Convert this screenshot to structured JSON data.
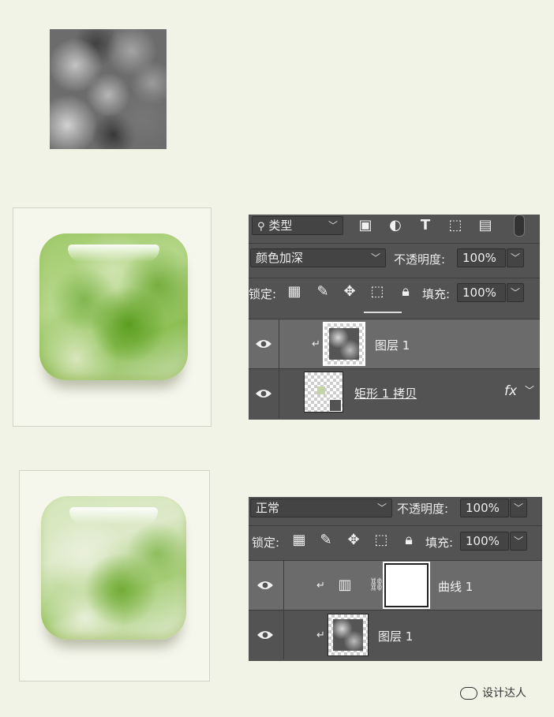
{
  "panel1": {
    "filter_kind_label": "类型",
    "blend_mode": "颜色加深",
    "opacity_label": "不透明度:",
    "opacity_value": "100%",
    "lock_label": "锁定:",
    "fill_label": "填充:",
    "fill_value": "100%",
    "layers": [
      {
        "name": "图层 1",
        "selected": true,
        "clipped": true
      },
      {
        "name": "矩形 1 拷贝",
        "selected": false,
        "clipped": false,
        "fx": "fx"
      }
    ]
  },
  "panel2": {
    "blend_mode": "正常",
    "opacity_label": "不透明度:",
    "opacity_value": "100%",
    "lock_label": "锁定:",
    "fill_label": "填充:",
    "fill_value": "100%",
    "layers": [
      {
        "name": "曲线 1",
        "selected": true,
        "clipped": true
      },
      {
        "name": "图层 1",
        "selected": false,
        "clipped": true
      }
    ]
  },
  "watermark": "设计达人",
  "colors": {
    "background": "#f1f3e6",
    "panel": "#535353",
    "selected_row": "#6b6b6b",
    "jade_green": "#8dbf55"
  }
}
